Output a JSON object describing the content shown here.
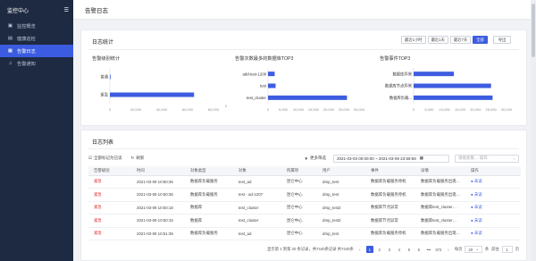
{
  "app": {
    "title": "监控中心",
    "collapse_icon": "menu-fold-icon"
  },
  "sidebar": {
    "items": [
      {
        "label": "监控概览",
        "icon": "dashboard-icon",
        "active": false
      },
      {
        "label": "健康巡检",
        "icon": "health-check-icon",
        "active": false
      },
      {
        "label": "告警日志",
        "icon": "alarm-log-icon",
        "active": true
      },
      {
        "label": "告警通知",
        "icon": "bell-icon",
        "active": false
      }
    ]
  },
  "header": {
    "title": "告警日志"
  },
  "stats": {
    "title": "日志统计",
    "ranges": [
      {
        "label": "最近1小时",
        "selected": false
      },
      {
        "label": "最近1天",
        "selected": false
      },
      {
        "label": "最近7天",
        "selected": false
      },
      {
        "label": "全部",
        "selected": true
      }
    ],
    "export_label": "导出"
  },
  "chart_data": [
    {
      "type": "bar",
      "orientation": "horizontal",
      "title": "告警级别统计",
      "categories": [
        "普通",
        "紧急"
      ],
      "values": [
        200,
        65000
      ],
      "xlim": [
        0,
        80000
      ],
      "xticks": [
        "0",
        "20,000",
        "40,000",
        "60,000",
        "80,000"
      ]
    },
    {
      "type": "bar",
      "orientation": "horizontal",
      "title": "告警次数最多的数据库TOP3",
      "categories": [
        "add-test-1208",
        "test",
        "test_cluster"
      ],
      "values": [
        2200,
        2500,
        26000
      ],
      "xlim": [
        0,
        30000
      ],
      "xticks": [
        "0",
        "5,000",
        "10,000",
        "15,000",
        "20,000",
        "25,000",
        "30,000"
      ]
    },
    {
      "type": "bar",
      "orientation": "horizontal",
      "title": "告警事件TOP3",
      "categories": [
        "数据库异常",
        "数据库节点异常",
        "数据库负载..."
      ],
      "values": [
        13000,
        25000,
        25500
      ],
      "xlim": [
        0,
        30000
      ],
      "xticks": [
        "0",
        "5,000",
        "10,000",
        "15,000",
        "20,000",
        "25,000",
        "30,000"
      ]
    }
  ],
  "chart_decor": {
    "bar_color": "#3d5ce0",
    "axis_color": "#d9dce3",
    "label_color": "#333333",
    "tick_color": "#8a8f99"
  },
  "chart_extra": {
    "chart1_right_tick": "0"
  },
  "list": {
    "title": "日志列表",
    "mark_all_read": "全部标记为已读",
    "refresh": "刷新",
    "more_filters": "更多筛选",
    "date_range": "2021-03-03 00:00:00 ~ 2021-03-09 23:59:59",
    "search_placeholder": "请搜索集…   操作",
    "columns": [
      "告警级别",
      "时间",
      "对象类型",
      "对象",
      "所属项",
      "用户",
      "事件",
      "详情",
      "操作"
    ],
    "rows": [
      {
        "level": "紧急",
        "time": "2021-03-09 10:50:36",
        "type": "数据库负载服务",
        "object": "test_ad",
        "site": "昆仑中心",
        "user": "dmp_test",
        "event": "数据库负载服务停机",
        "detail": "数据库负载服务出现…",
        "op": "未读"
      },
      {
        "level": "紧急",
        "time": "2021-03-09 10:50:36",
        "type": "数据库负载服务",
        "object": "test - ad-1207",
        "site": "昆仑中心",
        "user": "dmp_test",
        "event": "数据库负载服务停机",
        "detail": "数据库负载服务出现…",
        "op": "未读"
      },
      {
        "level": "紧急",
        "time": "2021-03-09 10:50:18",
        "type": "数据库",
        "object": "test_cluster",
        "site": "昆仑中心",
        "user": "dmp_test2",
        "event": "数据库节点异常",
        "detail": "数据库test_cluster…",
        "op": "未读"
      },
      {
        "level": "紧急",
        "time": "2021-03-09 10:50:15",
        "type": "数据库",
        "object": "test_cluster",
        "site": "昆仑中心",
        "user": "dmp_test2",
        "event": "数据库节点异常",
        "detail": "数据库test_cluster…",
        "op": "未读"
      },
      {
        "level": "紧急",
        "time": "2021-03-09 10:51:39",
        "type": "数据库负载服务",
        "object": "test_ad",
        "site": "昆仑中心",
        "user": "dmp_test",
        "event": "数据库负载服务停机",
        "detail": "数据库负载服务出现…",
        "op": "未读"
      }
    ]
  },
  "pagination": {
    "summary": "显示第 1 到第 20 条记录，共7440条记录 共7440条",
    "prev": "‹",
    "pages": [
      "1",
      "2",
      "3",
      "4",
      "5",
      "6",
      "•••",
      "372"
    ],
    "current": "1",
    "next": "›",
    "per_page_prefix": "每页",
    "per_page": "20",
    "per_page_suffix": "条",
    "goto_label": "前往",
    "goto_value": "1",
    "page_suffix": "页"
  }
}
